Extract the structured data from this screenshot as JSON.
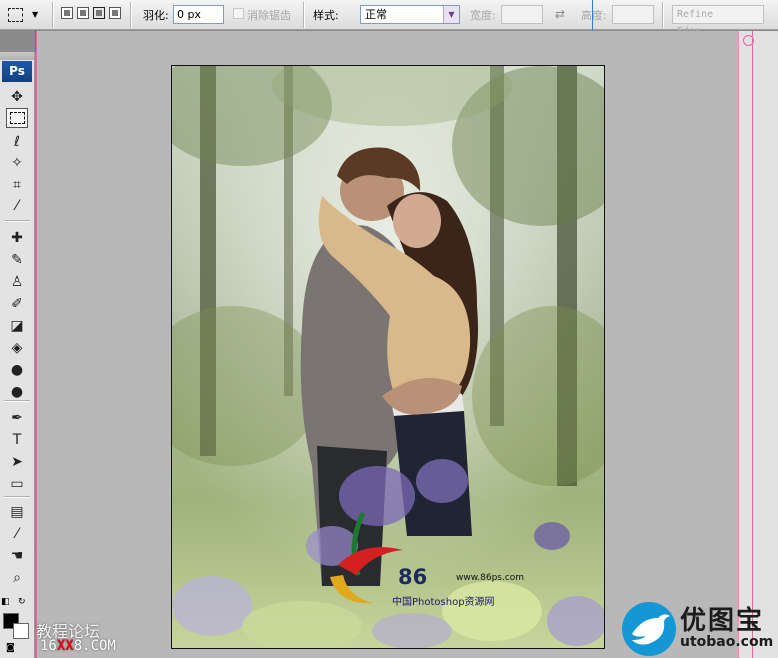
{
  "options_bar": {
    "feather_label": "羽化:",
    "feather_value": "0 px",
    "antialias_label": "消除锯齿",
    "style_label": "样式:",
    "style_value": "正常",
    "width_label": "宽度:",
    "height_label": "高度:",
    "refine_edge_label": "Refine Edge..."
  },
  "tools_panel": {
    "logo": "Ps",
    "tools": [
      {
        "name": "move-tool-icon",
        "glyph": "✥"
      },
      {
        "name": "rect-marquee-tool-icon",
        "glyph": ""
      },
      {
        "name": "lasso-tool-icon",
        "glyph": "ℓ"
      },
      {
        "name": "magic-wand-tool-icon",
        "glyph": "✧"
      },
      {
        "name": "crop-tool-icon",
        "glyph": "⌗"
      },
      {
        "name": "eyedropper-tool-icon",
        "glyph": "⁄"
      },
      {
        "name": "healing-brush-tool-icon",
        "glyph": "✚"
      },
      {
        "name": "brush-tool-icon",
        "glyph": "✎"
      },
      {
        "name": "clone-stamp-tool-icon",
        "glyph": "♙"
      },
      {
        "name": "history-brush-tool-icon",
        "glyph": "✐"
      },
      {
        "name": "eraser-tool-icon",
        "glyph": "◪"
      },
      {
        "name": "paint-bucket-tool-icon",
        "glyph": "◈"
      },
      {
        "name": "blur-tool-icon",
        "glyph": "●"
      },
      {
        "name": "dodge-tool-icon",
        "glyph": "●"
      },
      {
        "name": "pen-tool-icon",
        "glyph": "✒"
      },
      {
        "name": "type-tool-icon",
        "glyph": "T"
      },
      {
        "name": "path-selection-tool-icon",
        "glyph": "➤"
      },
      {
        "name": "rectangle-shape-tool-icon",
        "glyph": "▭"
      },
      {
        "name": "notes-tool-icon",
        "glyph": "▤"
      },
      {
        "name": "eyedropper2-tool-icon",
        "glyph": "⁄"
      },
      {
        "name": "hand-tool-icon",
        "glyph": "☚"
      },
      {
        "name": "zoom-tool-icon",
        "glyph": "⌕"
      }
    ]
  },
  "watermarks": {
    "forum_text": "教程论坛",
    "site_prefix": "16",
    "site_xx": "XX",
    "site_suffix": "8.COM",
    "brand_name": "优图宝",
    "brand_url": "utobao.com",
    "logo86_num": "86",
    "logo86_url": "www.86ps.com",
    "logo86_cn": "中国Photoshop资源网"
  },
  "colors": {
    "foreground": "#000000",
    "background": "#ffffff",
    "guide": "#2b7fd7",
    "guide_pink": "#e26aa1"
  }
}
